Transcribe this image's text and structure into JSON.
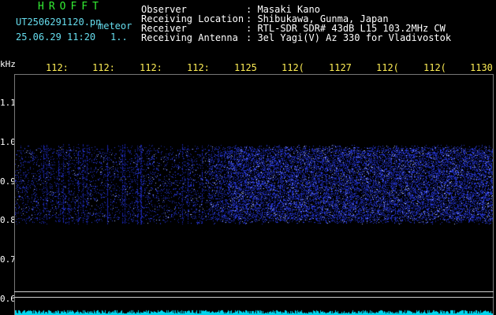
{
  "header": {
    "brand": "HROFFT",
    "file_name": "UT2506291120.pn",
    "tag": "meteor",
    "date_time": "25.06.29 11:20",
    "frame_index": "1..",
    "fields": [
      {
        "label": "Observer",
        "value": ": Masaki Kano"
      },
      {
        "label": "Receiving Location",
        "value": ": Shibukawa, Gunma, Japan"
      },
      {
        "label": "Receiver",
        "value": ": RTL-SDR SDR# 43dB L15 103.2MHz CW"
      },
      {
        "label": "Receiving Antenna",
        "value": ": 3el Yagi(V) Az 330 for Vladivostok"
      }
    ]
  },
  "y_axis": {
    "unit": "kHz",
    "labels": [
      "1.1",
      "1.0",
      "0.9",
      "0.8",
      "0.7",
      "0.6"
    ]
  },
  "x_axis": {
    "labels": [
      "112:",
      "112:",
      "112:",
      "112:",
      "1125",
      "112(",
      "1127",
      "112(",
      "112(",
      "1130"
    ]
  },
  "colors": {
    "background": "#000000",
    "signal": "#2a3cff",
    "bright": "#aab8ff",
    "baseline": "#00d6ee"
  }
}
